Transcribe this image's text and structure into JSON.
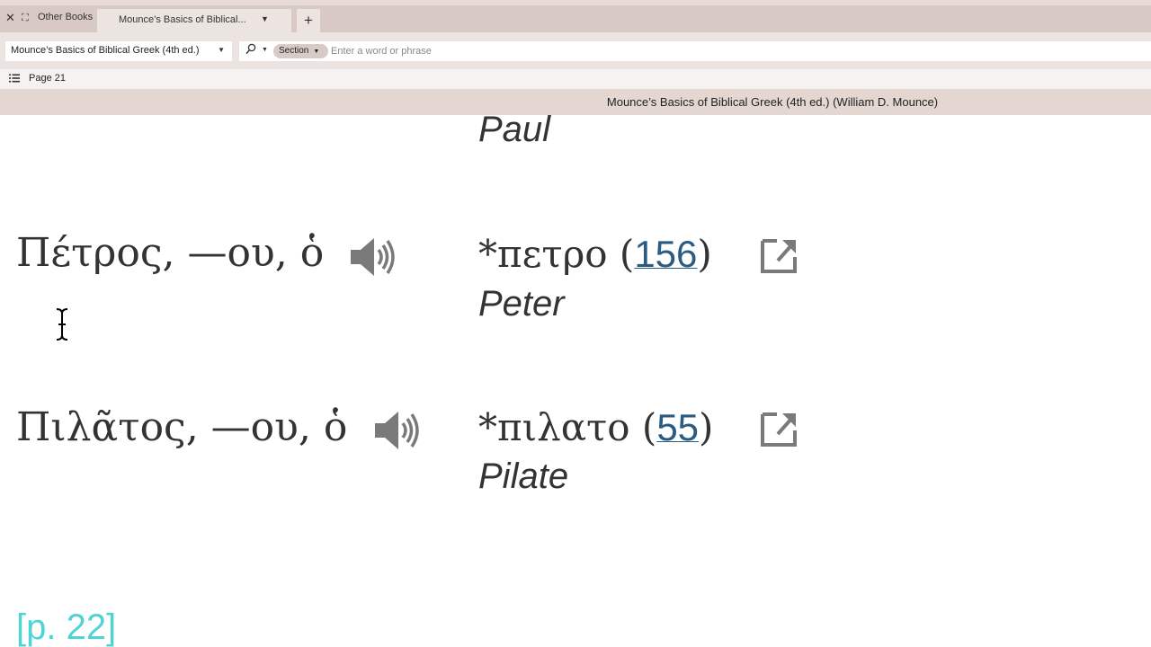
{
  "tabbar": {
    "close_icon": "✕",
    "expand_icon": "⛶",
    "other_books": "Other Books",
    "active_tab": "Mounce’s Basics of Biblical...",
    "add_tab": "+"
  },
  "toolbar": {
    "book_selector": "Mounce’s Basics of Biblical Greek (4th ed.)",
    "search_scope": "Section",
    "search_placeholder": "Enter a word or phrase",
    "search_value": ""
  },
  "pagebar": {
    "page_label": "Page 21"
  },
  "title": "Mounce’s Basics of Biblical Greek (4th ed.) (William D. Mounce)",
  "entries": [
    {
      "gloss": "Paul"
    },
    {
      "headword": "Πέτρος, —ου, ὁ",
      "root": "*πετρο",
      "count": "156",
      "gloss": "Peter"
    },
    {
      "headword": "Πιλᾶτος, —ου, ὁ",
      "root": "*πιλατο",
      "count": "55",
      "gloss": "Pilate"
    }
  ],
  "page_marker": "[p. 22]",
  "colors": {
    "tabbar": "#d9c9c4",
    "toolbar": "#ece4e1",
    "titlebar": "#e4d6d1",
    "link": "#2a5b82",
    "page_marker": "#4fd4d6"
  }
}
